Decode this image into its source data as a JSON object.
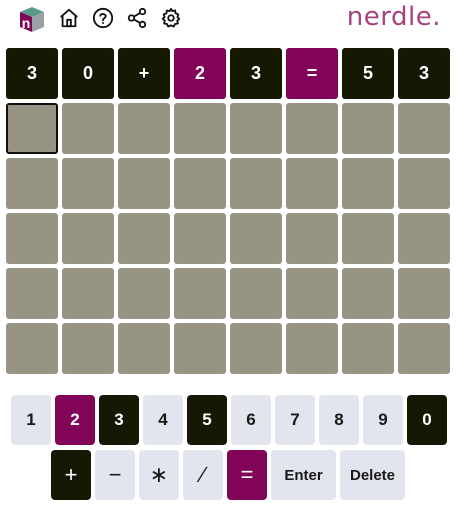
{
  "header": {
    "brand": "nerdle.",
    "logo_letter": "n",
    "icons": [
      "home-icon",
      "help-icon",
      "share-icon",
      "settings-icon"
    ]
  },
  "colors": {
    "empty": "#989484",
    "black": "#161803",
    "purple": "#820458",
    "key_default": "#e2e5ee",
    "brand": "#a6427f"
  },
  "board": {
    "rows": [
      [
        {
          "char": "3",
          "state": "black"
        },
        {
          "char": "0",
          "state": "black"
        },
        {
          "char": "+",
          "state": "black"
        },
        {
          "char": "2",
          "state": "purple"
        },
        {
          "char": "3",
          "state": "black"
        },
        {
          "char": "=",
          "state": "purple"
        },
        {
          "char": "5",
          "state": "black"
        },
        {
          "char": "3",
          "state": "black"
        }
      ],
      [
        {
          "char": "",
          "state": "active"
        },
        {
          "char": "",
          "state": "empty"
        },
        {
          "char": "",
          "state": "empty"
        },
        {
          "char": "",
          "state": "empty"
        },
        {
          "char": "",
          "state": "empty"
        },
        {
          "char": "",
          "state": "empty"
        },
        {
          "char": "",
          "state": "empty"
        },
        {
          "char": "",
          "state": "empty"
        }
      ],
      [
        {
          "char": "",
          "state": "empty"
        },
        {
          "char": "",
          "state": "empty"
        },
        {
          "char": "",
          "state": "empty"
        },
        {
          "char": "",
          "state": "empty"
        },
        {
          "char": "",
          "state": "empty"
        },
        {
          "char": "",
          "state": "empty"
        },
        {
          "char": "",
          "state": "empty"
        },
        {
          "char": "",
          "state": "empty"
        }
      ],
      [
        {
          "char": "",
          "state": "empty"
        },
        {
          "char": "",
          "state": "empty"
        },
        {
          "char": "",
          "state": "empty"
        },
        {
          "char": "",
          "state": "empty"
        },
        {
          "char": "",
          "state": "empty"
        },
        {
          "char": "",
          "state": "empty"
        },
        {
          "char": "",
          "state": "empty"
        },
        {
          "char": "",
          "state": "empty"
        }
      ],
      [
        {
          "char": "",
          "state": "empty"
        },
        {
          "char": "",
          "state": "empty"
        },
        {
          "char": "",
          "state": "empty"
        },
        {
          "char": "",
          "state": "empty"
        },
        {
          "char": "",
          "state": "empty"
        },
        {
          "char": "",
          "state": "empty"
        },
        {
          "char": "",
          "state": "empty"
        },
        {
          "char": "",
          "state": "empty"
        }
      ],
      [
        {
          "char": "",
          "state": "empty"
        },
        {
          "char": "",
          "state": "empty"
        },
        {
          "char": "",
          "state": "empty"
        },
        {
          "char": "",
          "state": "empty"
        },
        {
          "char": "",
          "state": "empty"
        },
        {
          "char": "",
          "state": "empty"
        },
        {
          "char": "",
          "state": "empty"
        },
        {
          "char": "",
          "state": "empty"
        }
      ]
    ]
  },
  "keyboard": {
    "digits": [
      {
        "label": "1",
        "state": "default"
      },
      {
        "label": "2",
        "state": "purple"
      },
      {
        "label": "3",
        "state": "black"
      },
      {
        "label": "4",
        "state": "default"
      },
      {
        "label": "5",
        "state": "black"
      },
      {
        "label": "6",
        "state": "default"
      },
      {
        "label": "7",
        "state": "default"
      },
      {
        "label": "8",
        "state": "default"
      },
      {
        "label": "9",
        "state": "default"
      },
      {
        "label": "0",
        "state": "black"
      }
    ],
    "operators": [
      {
        "label": "+",
        "state": "black",
        "name": "plus"
      },
      {
        "label": "−",
        "state": "default",
        "name": "minus"
      },
      {
        "label": "∗",
        "state": "default",
        "name": "multiply"
      },
      {
        "label": "∕",
        "state": "default",
        "name": "divide"
      },
      {
        "label": "=",
        "state": "purple",
        "name": "equals"
      }
    ],
    "enter_label": "Enter",
    "delete_label": "Delete"
  }
}
